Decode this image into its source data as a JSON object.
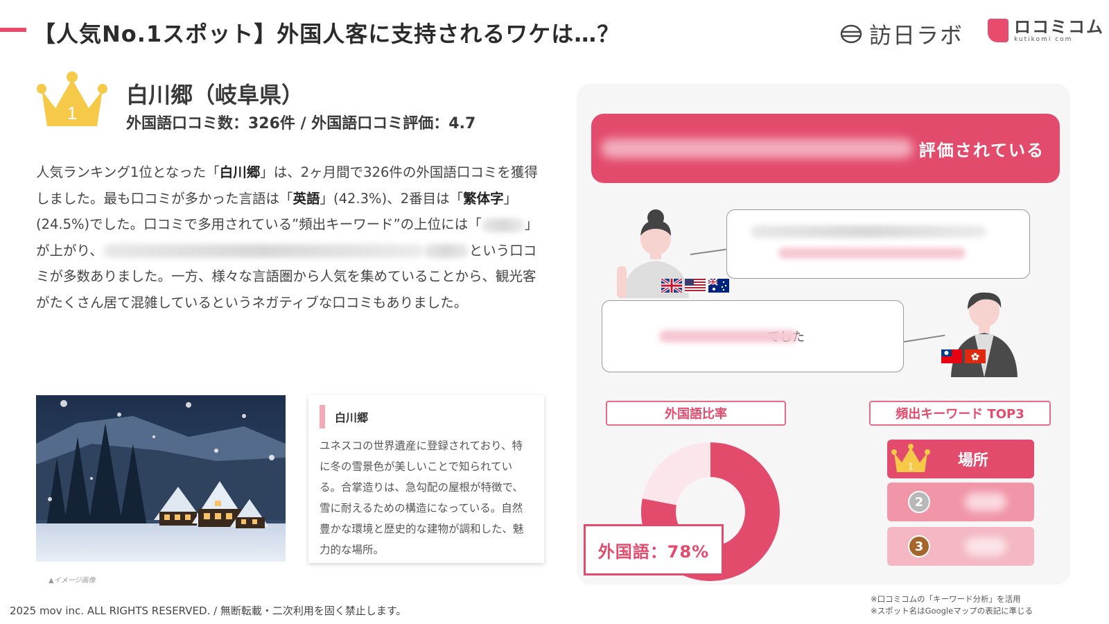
{
  "header": {
    "title": "【人気No.1スポット】外国人客に支持されるワケは…？",
    "logo_hojin": "訪日ラボ",
    "logo_kuchikomi_main": "ロコミコム",
    "logo_kuchikomi_sub": "kutikomi com"
  },
  "spot": {
    "rank": "1",
    "name": "白川郷（岐阜県）",
    "stats": "外国語口コミ数：326件 / 外国語口コミ評価：4.7"
  },
  "description": {
    "p1": "人気ランキング1位となった「",
    "b1": "白川郷",
    "p2": "」は、2ヶ月間で326件の外国語口コミを獲得しました。最も口コミが多かった言語は「",
    "b2": "英語",
    "p3": "」(42.3%)、2番目は「",
    "b3": "繁体字",
    "p4": "」(24.5%)でした。口コミで多用されている”頻出キーワード”の上位には「",
    "p5": "」が上がり、",
    "p6": "という口コミが多数ありました。一方、様々な言語圏から人気を集めていることから、観光客がたくさん居て混雑しているというネガティブな口コミもありました。"
  },
  "photo": {
    "caption": "▲イメージ画像"
  },
  "info_card": {
    "title": "白川郷",
    "body": "ユネスコの世界遺産に登録されており、特に冬の雪景色が美しいことで知られている。合掌造りは、急勾配の屋根が特徴で、雪に耐えるための構造になっている。自然豊かな環境と歴史的な建物が調和した、魅力的な場所。"
  },
  "panel": {
    "banner_text": "評価されている",
    "bubble2_text": "でした",
    "ratio_label": "外国語比率",
    "keywords_label": "頻出キーワード TOP3",
    "donut_text": "外国語：78%",
    "foreign_ratio": 0.78,
    "rank1_word": "場所",
    "rank_numbers": [
      "1",
      "2",
      "3"
    ]
  },
  "colors": {
    "accent": "#e34b6d",
    "accent_light": "#f195a8",
    "accent_lighter": "#f4b7c3",
    "crown": "#f7c948",
    "panel_bg": "#f6f6f6"
  },
  "footer": {
    "copyright": "2025 mov inc. ALL RIGHTS RESERVED. / 無断転載・二次利用を固く禁止します。",
    "note1": "※口コミコムの「キーワード分析」を活用",
    "note2": "※スポット名はGoogleマップの表記に準じる"
  }
}
